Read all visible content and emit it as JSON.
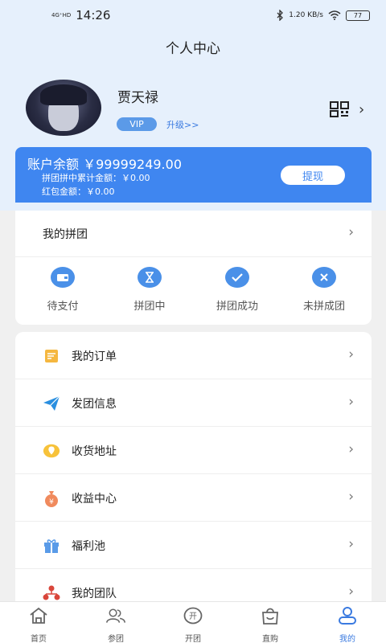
{
  "status_bar": {
    "signal": "4G⁺HD",
    "time": "14:26",
    "speed": "1.20 KB/s",
    "battery": "77"
  },
  "header": {
    "title": "个人中心"
  },
  "profile": {
    "name": "贾天禄",
    "vip_label": "VIP",
    "upgrade_label": "升级>>"
  },
  "balance": {
    "label": "账户余额",
    "value": "￥99999249.00",
    "accumulated_label": "拼团拼中累计金额：",
    "accumulated_value": "￥0.00",
    "redpacket_label": "红包金额：",
    "redpacket_value": "￥0.00",
    "withdraw_label": "提现"
  },
  "group_section": {
    "title": "我的拼团",
    "statuses": [
      {
        "label": "待支付",
        "icon": "wallet-icon"
      },
      {
        "label": "拼团中",
        "icon": "hourglass-icon"
      },
      {
        "label": "拼团成功",
        "icon": "check-icon"
      },
      {
        "label": "未拼成团",
        "icon": "close-icon"
      }
    ]
  },
  "menu": [
    {
      "label": "我的订单",
      "icon": "order-icon"
    },
    {
      "label": "发团信息",
      "icon": "send-icon"
    },
    {
      "label": "收货地址",
      "icon": "location-icon"
    },
    {
      "label": "收益中心",
      "icon": "money-bag-icon"
    },
    {
      "label": "福利池",
      "icon": "gift-icon"
    },
    {
      "label": "我的团队",
      "icon": "team-icon"
    }
  ],
  "tabs": [
    {
      "label": "首页",
      "icon": "home-icon"
    },
    {
      "label": "参团",
      "icon": "people-icon"
    },
    {
      "label": "开团",
      "icon": "open-group-icon"
    },
    {
      "label": "直购",
      "icon": "shopping-bag-icon"
    },
    {
      "label": "我的",
      "icon": "user-icon",
      "active": true
    }
  ],
  "colors": {
    "primary": "#3f86f0",
    "header_bg": "#e6f0fc",
    "page_bg": "#f0f0f0"
  }
}
